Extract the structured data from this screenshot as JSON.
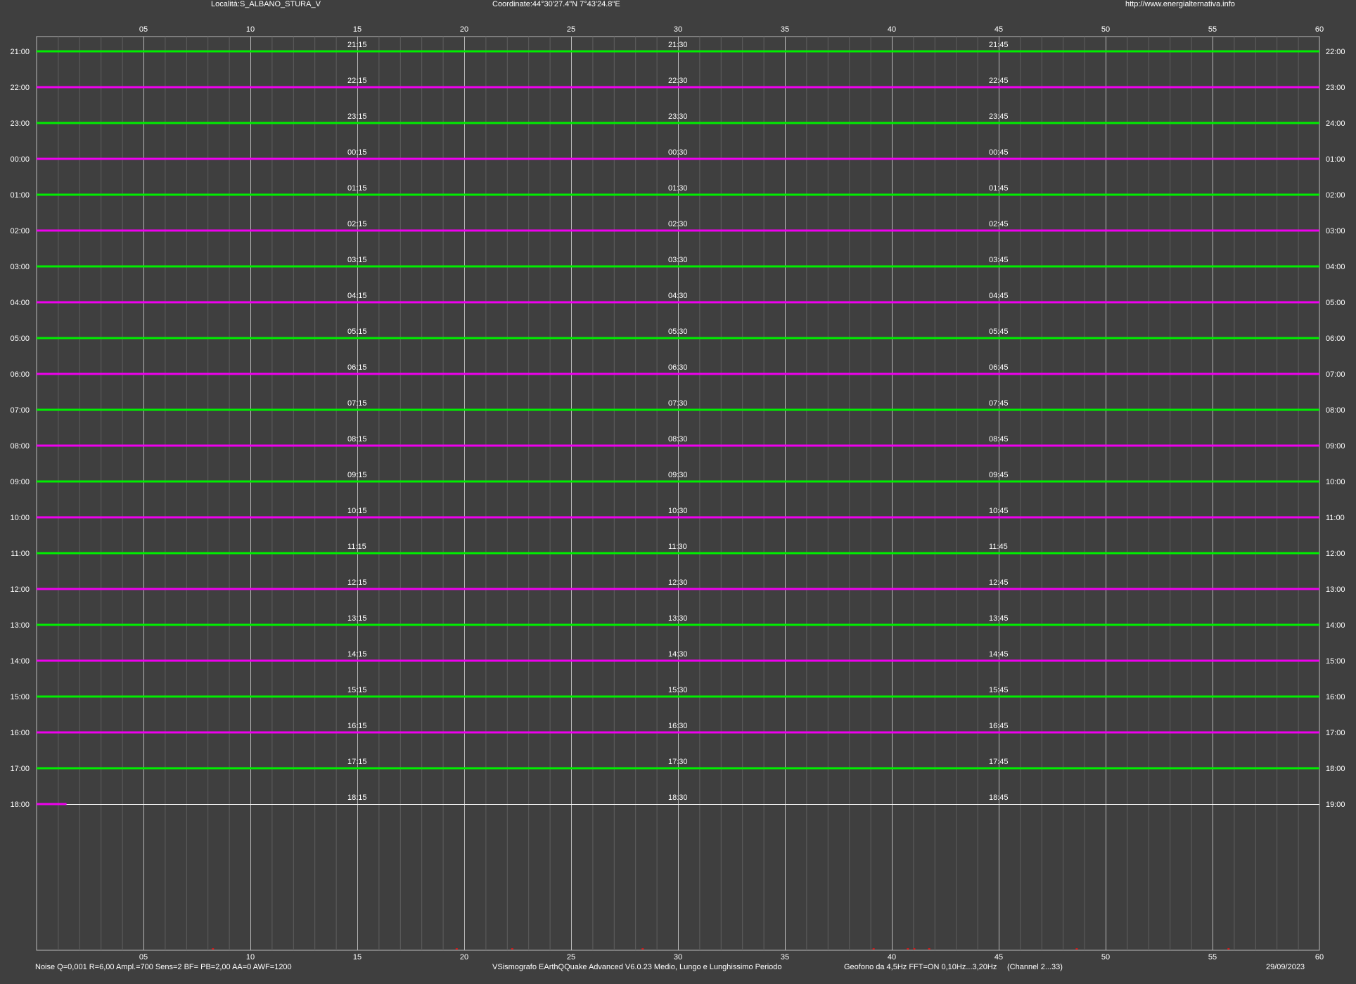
{
  "header": {
    "location": "Località:S_ALBANO_STURA_V",
    "coordinates": "Coordinate:44°30'27.4\"N 7°43'24.8\"E",
    "url": "http://www.energialternativa.info"
  },
  "footer": {
    "params": "Noise Q=0,001 R=6,00 Ampl.=700 Sens=2 BF= PB=2,00 AA=0 AWF=1200",
    "software": "VSismografo  EArthQQuake Advanced V6.0.23  Medio, Lungo e Lunghissimo Periodo",
    "sensor": "Geofono da 4,5Hz FFT=ON 0,10Hz...3,20Hz",
    "channels": "(Channel 2...33)",
    "date": "29/09/2023"
  },
  "colors": {
    "background": "#3f3f3f",
    "trace_even": "#00ee00",
    "trace_odd": "#ee00ee",
    "major_grid": "#b8b8b8",
    "minor_grid": "#5e5e5e",
    "event_markers": "#cc1a1a"
  },
  "chart_data": {
    "type": "line",
    "title": "",
    "xlabel": "",
    "ylabel": "",
    "xlim": [
      0,
      60
    ],
    "x_unit": "minutes",
    "minor_grid_step": 1,
    "x_ticks": [
      "05",
      "10",
      "15",
      "20",
      "25",
      "30",
      "35",
      "40",
      "45",
      "50",
      "55",
      "60"
    ],
    "traces": [
      {
        "left_label": "21:00",
        "right_label": "22:00",
        "marks": [
          "21:15",
          "21:30",
          "21:45"
        ],
        "color": "green",
        "duration_min": 60
      },
      {
        "left_label": "22:00",
        "right_label": "23:00",
        "marks": [
          "22:15",
          "22:30",
          "22:45"
        ],
        "color": "magenta",
        "duration_min": 60
      },
      {
        "left_label": "23:00",
        "right_label": "24:00",
        "marks": [
          "23:15",
          "23:30",
          "23:45"
        ],
        "color": "green",
        "duration_min": 60
      },
      {
        "left_label": "00:00",
        "right_label": "01:00",
        "marks": [
          "00:15",
          "00:30",
          "00:45"
        ],
        "color": "magenta",
        "duration_min": 60
      },
      {
        "left_label": "01:00",
        "right_label": "02:00",
        "marks": [
          "01:15",
          "01:30",
          "01:45"
        ],
        "color": "green",
        "duration_min": 60
      },
      {
        "left_label": "02:00",
        "right_label": "03:00",
        "marks": [
          "02:15",
          "02:30",
          "02:45"
        ],
        "color": "magenta",
        "duration_min": 60
      },
      {
        "left_label": "03:00",
        "right_label": "04:00",
        "marks": [
          "03:15",
          "03:30",
          "03:45"
        ],
        "color": "green",
        "duration_min": 60
      },
      {
        "left_label": "04:00",
        "right_label": "05:00",
        "marks": [
          "04:15",
          "04:30",
          "04:45"
        ],
        "color": "magenta",
        "duration_min": 60
      },
      {
        "left_label": "05:00",
        "right_label": "06:00",
        "marks": [
          "05:15",
          "05:30",
          "05:45"
        ],
        "color": "green",
        "duration_min": 60
      },
      {
        "left_label": "06:00",
        "right_label": "07:00",
        "marks": [
          "06:15",
          "06:30",
          "06:45"
        ],
        "color": "magenta",
        "duration_min": 60
      },
      {
        "left_label": "07:00",
        "right_label": "08:00",
        "marks": [
          "07:15",
          "07:30",
          "07:45"
        ],
        "color": "green",
        "duration_min": 60
      },
      {
        "left_label": "08:00",
        "right_label": "09:00",
        "marks": [
          "08:15",
          "08:30",
          "08:45"
        ],
        "color": "magenta",
        "duration_min": 60
      },
      {
        "left_label": "09:00",
        "right_label": "10:00",
        "marks": [
          "09:15",
          "09:30",
          "09:45"
        ],
        "color": "green",
        "duration_min": 60
      },
      {
        "left_label": "10:00",
        "right_label": "11:00",
        "marks": [
          "10:15",
          "10:30",
          "10:45"
        ],
        "color": "magenta",
        "duration_min": 60
      },
      {
        "left_label": "11:00",
        "right_label": "12:00",
        "marks": [
          "11:15",
          "11:30",
          "11:45"
        ],
        "color": "green",
        "duration_min": 60
      },
      {
        "left_label": "12:00",
        "right_label": "13:00",
        "marks": [
          "12:15",
          "12:30",
          "12:45"
        ],
        "color": "magenta",
        "duration_min": 60
      },
      {
        "left_label": "13:00",
        "right_label": "14:00",
        "marks": [
          "13:15",
          "13:30",
          "13:45"
        ],
        "color": "green",
        "duration_min": 60
      },
      {
        "left_label": "14:00",
        "right_label": "15:00",
        "marks": [
          "14:15",
          "14:30",
          "14:45"
        ],
        "color": "magenta",
        "duration_min": 60
      },
      {
        "left_label": "15:00",
        "right_label": "16:00",
        "marks": [
          "15:15",
          "15:30",
          "15:45"
        ],
        "color": "green",
        "duration_min": 60
      },
      {
        "left_label": "16:00",
        "right_label": "17:00",
        "marks": [
          "16:15",
          "16:30",
          "16:45"
        ],
        "color": "magenta",
        "duration_min": 60
      },
      {
        "left_label": "17:00",
        "right_label": "18:00",
        "marks": [
          "17:15",
          "17:30",
          "17:45"
        ],
        "color": "green",
        "duration_min": 60
      },
      {
        "left_label": "18:00",
        "right_label": "19:00",
        "marks": [
          "18:15",
          "18:30",
          "18:45"
        ],
        "color": "magenta",
        "duration_min": 1.4
      }
    ],
    "bottom_event_markers_min": [
      8.2,
      19.6,
      22.2,
      28.3,
      39.1,
      40.7,
      41.0,
      41.7,
      48.6,
      55.7
    ]
  }
}
